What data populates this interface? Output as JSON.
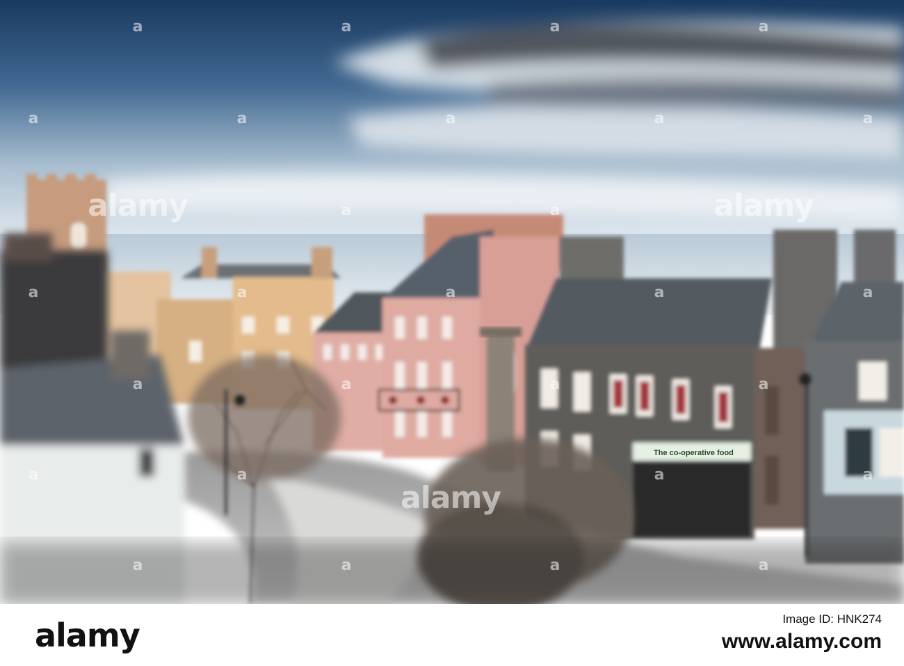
{
  "watermark": {
    "logo": "alamy",
    "mark": "a"
  },
  "shop": {
    "sign_text": "The co-operative food"
  },
  "footer": {
    "logo": "alamy",
    "image_id": "Image ID: HNK274",
    "url": "www.alamy.com"
  },
  "colors": {
    "sky_top": "#1d3f66",
    "sky_mid": "#5b7ea3",
    "sea": "#9fb6c9",
    "pink_facade": "#d9a9a0",
    "yellow_facade": "#d9b98c",
    "stone": "#6d6c6a",
    "slate_roof": "#4e5458"
  }
}
